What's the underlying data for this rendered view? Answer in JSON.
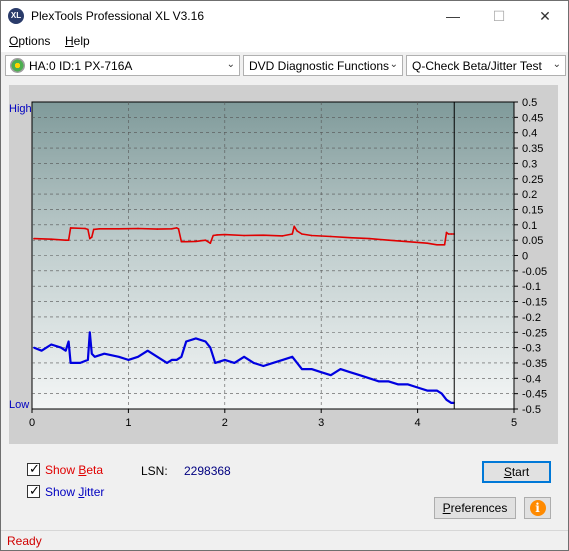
{
  "window": {
    "title": "PlexTools Professional XL V3.16",
    "app_icon": "XL",
    "minimize_glyph": "—",
    "maximize_glyph": "☐",
    "close_glyph": "✕"
  },
  "menu": {
    "items": [
      {
        "label": "Options",
        "mnemonic": "O"
      },
      {
        "label": "Help",
        "mnemonic": "H"
      }
    ]
  },
  "toolbar": {
    "drive": "HA:0 ID:1  PX-716A",
    "function": "DVD Diagnostic Functions",
    "test": "Q-Check Beta/Jitter Test",
    "dropdown_glyph": "⌄"
  },
  "chart_data": {
    "type": "line",
    "left_axis_labels": {
      "top": "High",
      "bottom": "Low"
    },
    "x": {
      "min": 0,
      "max": 5,
      "ticks": [
        "0",
        "1",
        "2",
        "3",
        "4",
        "5"
      ]
    },
    "y_right": {
      "min": -0.5,
      "max": 0.5,
      "ticks": [
        "0.5",
        "0.45",
        "0.4",
        "0.35",
        "0.3",
        "0.25",
        "0.2",
        "0.15",
        "0.1",
        "0.05",
        "0",
        "-0.05",
        "-0.1",
        "-0.15",
        "-0.2",
        "-0.25",
        "-0.3",
        "-0.35",
        "-0.4",
        "-0.45",
        "-0.5"
      ]
    },
    "grid": true,
    "cursor_x": 4.38,
    "series": [
      {
        "color": "#e00000",
        "x": [
          0.02,
          0.2,
          0.35,
          0.38,
          0.4,
          0.55,
          0.58,
          0.6,
          0.62,
          0.64,
          0.7,
          0.9,
          1.1,
          1.3,
          1.45,
          1.5,
          1.52,
          1.55,
          1.6,
          1.7,
          1.8,
          1.85,
          1.88,
          1.92,
          2.0,
          2.2,
          2.4,
          2.6,
          2.7,
          2.72,
          2.75,
          2.8,
          2.9,
          3.1,
          3.3,
          3.5,
          3.7,
          3.9,
          4.1,
          4.2,
          4.28,
          4.3,
          4.32,
          4.35,
          4.38
        ],
        "y": [
          0.055,
          0.053,
          0.05,
          0.05,
          0.09,
          0.088,
          0.085,
          0.055,
          0.06,
          0.085,
          0.087,
          0.087,
          0.088,
          0.086,
          0.087,
          0.09,
          0.087,
          0.045,
          0.045,
          0.046,
          0.05,
          0.04,
          0.065,
          0.067,
          0.068,
          0.065,
          0.066,
          0.064,
          0.07,
          0.095,
          0.08,
          0.07,
          0.065,
          0.062,
          0.058,
          0.055,
          0.05,
          0.045,
          0.04,
          0.035,
          0.035,
          0.075,
          0.07,
          0.07,
          0.07
        ]
      },
      {
        "color": "#0000e0",
        "x": [
          0.02,
          0.1,
          0.2,
          0.3,
          0.35,
          0.38,
          0.4,
          0.5,
          0.58,
          0.6,
          0.62,
          0.65,
          0.75,
          0.9,
          1.0,
          1.1,
          1.2,
          1.3,
          1.4,
          1.45,
          1.5,
          1.55,
          1.6,
          1.7,
          1.8,
          1.85,
          1.9,
          2.0,
          2.1,
          2.2,
          2.3,
          2.4,
          2.5,
          2.6,
          2.7,
          2.8,
          2.9,
          3.0,
          3.1,
          3.2,
          3.3,
          3.4,
          3.5,
          3.6,
          3.7,
          3.8,
          3.9,
          4.0,
          4.1,
          4.2,
          4.25,
          4.3,
          4.35,
          4.38
        ],
        "y": [
          -0.3,
          -0.31,
          -0.29,
          -0.3,
          -0.31,
          -0.28,
          -0.35,
          -0.35,
          -0.34,
          -0.25,
          -0.32,
          -0.33,
          -0.32,
          -0.33,
          -0.34,
          -0.33,
          -0.31,
          -0.33,
          -0.35,
          -0.34,
          -0.34,
          -0.33,
          -0.28,
          -0.27,
          -0.28,
          -0.3,
          -0.35,
          -0.34,
          -0.35,
          -0.33,
          -0.35,
          -0.36,
          -0.35,
          -0.34,
          -0.33,
          -0.37,
          -0.37,
          -0.38,
          -0.39,
          -0.37,
          -0.38,
          -0.39,
          -0.4,
          -0.41,
          -0.41,
          -0.42,
          -0.42,
          -0.43,
          -0.44,
          -0.44,
          -0.45,
          -0.47,
          -0.48,
          -0.48
        ]
      }
    ]
  },
  "controls": {
    "show_beta": {
      "label": "Show Beta",
      "mnemonic": "B",
      "checked": true,
      "color": "#e00000"
    },
    "show_jitter": {
      "label": "Show Jitter",
      "mnemonic": "J",
      "checked": true,
      "color": "#0000c0"
    },
    "lsn_label": "LSN:",
    "lsn_value": "2298368",
    "start_label": "Start",
    "preferences_label": "Preferences",
    "info_icon": "i",
    "checkmark": "✓"
  },
  "status": {
    "text": "Ready"
  }
}
